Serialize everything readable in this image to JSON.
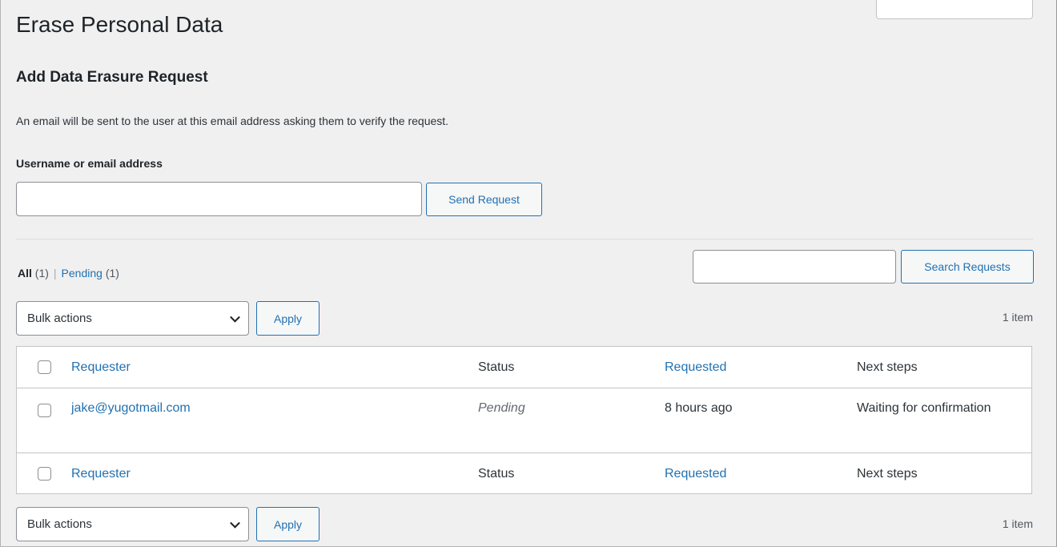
{
  "page": {
    "title": "Erase Personal Data"
  },
  "add_request": {
    "heading": "Add Data Erasure Request",
    "description": "An email will be sent to the user at this email address asking them to verify the request.",
    "field_label": "Username or email address",
    "field_value": "",
    "send_button": "Send Request"
  },
  "filters": {
    "all_label": "All",
    "all_count": "(1)",
    "separator": "|",
    "pending_label": "Pending",
    "pending_count": "(1)"
  },
  "search": {
    "value": "",
    "button": "Search Requests"
  },
  "bulk_top": {
    "select_value": "Bulk actions",
    "apply": "Apply",
    "item_count": "1 item"
  },
  "bulk_bottom": {
    "select_value": "Bulk actions",
    "apply": "Apply",
    "item_count": "1 item"
  },
  "table": {
    "columns": {
      "requester": "Requester",
      "status": "Status",
      "requested": "Requested",
      "next_steps": "Next steps"
    },
    "rows": [
      {
        "requester": "jake@yugotmail.com",
        "status": "Pending",
        "requested": "8 hours ago",
        "next_steps": "Waiting for confirmation"
      }
    ]
  },
  "colors": {
    "link": "#2271b1",
    "background": "#f0f0f1"
  }
}
